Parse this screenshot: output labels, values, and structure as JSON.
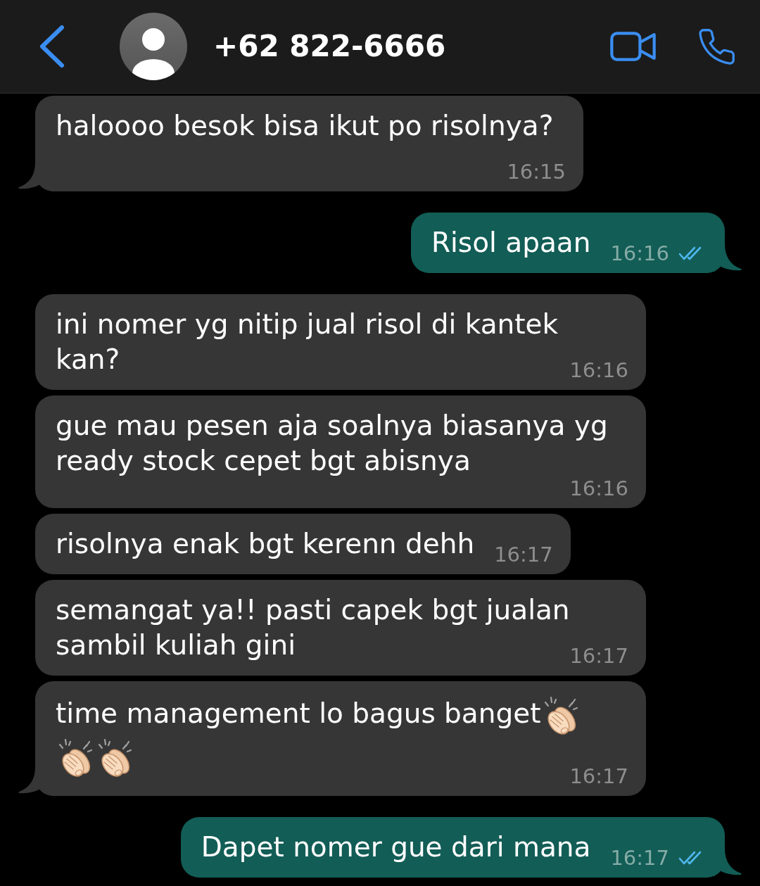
{
  "header": {
    "title": "+62 822-6666"
  },
  "messages": [
    {
      "kind": "incoming",
      "text": "haloooo besok bisa ikut po risolnya?",
      "time": "16:15",
      "tail": true
    },
    {
      "kind": "outgoing",
      "text": "Risol apaan",
      "time": "16:16",
      "read": true,
      "tail": true
    },
    {
      "kind": "incoming",
      "text": "ini nomer yg nitip jual risol di kantek kan?",
      "time": "16:16",
      "tail": false
    },
    {
      "kind": "incoming",
      "text": "gue mau pesen aja soalnya biasanya yg ready stock cepet bgt abisnya",
      "time": "16:16",
      "tail": false
    },
    {
      "kind": "incoming",
      "text": "risolnya enak bgt kerenn dehh",
      "time": "16:17",
      "tail": false
    },
    {
      "kind": "incoming",
      "text": "semangat ya!! pasti capek bgt jualan sambil kuliah gini",
      "time": "16:17",
      "tail": false
    },
    {
      "kind": "incoming",
      "text": "time management lo bagus banget",
      "emojis": [
        {
          "kind": "clap"
        },
        {
          "kind": "clap"
        },
        {
          "kind": "clap"
        }
      ],
      "time": "16:17",
      "tail": true
    },
    {
      "kind": "outgoing",
      "text": "Dapet nomer gue dari mana",
      "time": "16:17",
      "read": true,
      "tail": true
    }
  ]
}
